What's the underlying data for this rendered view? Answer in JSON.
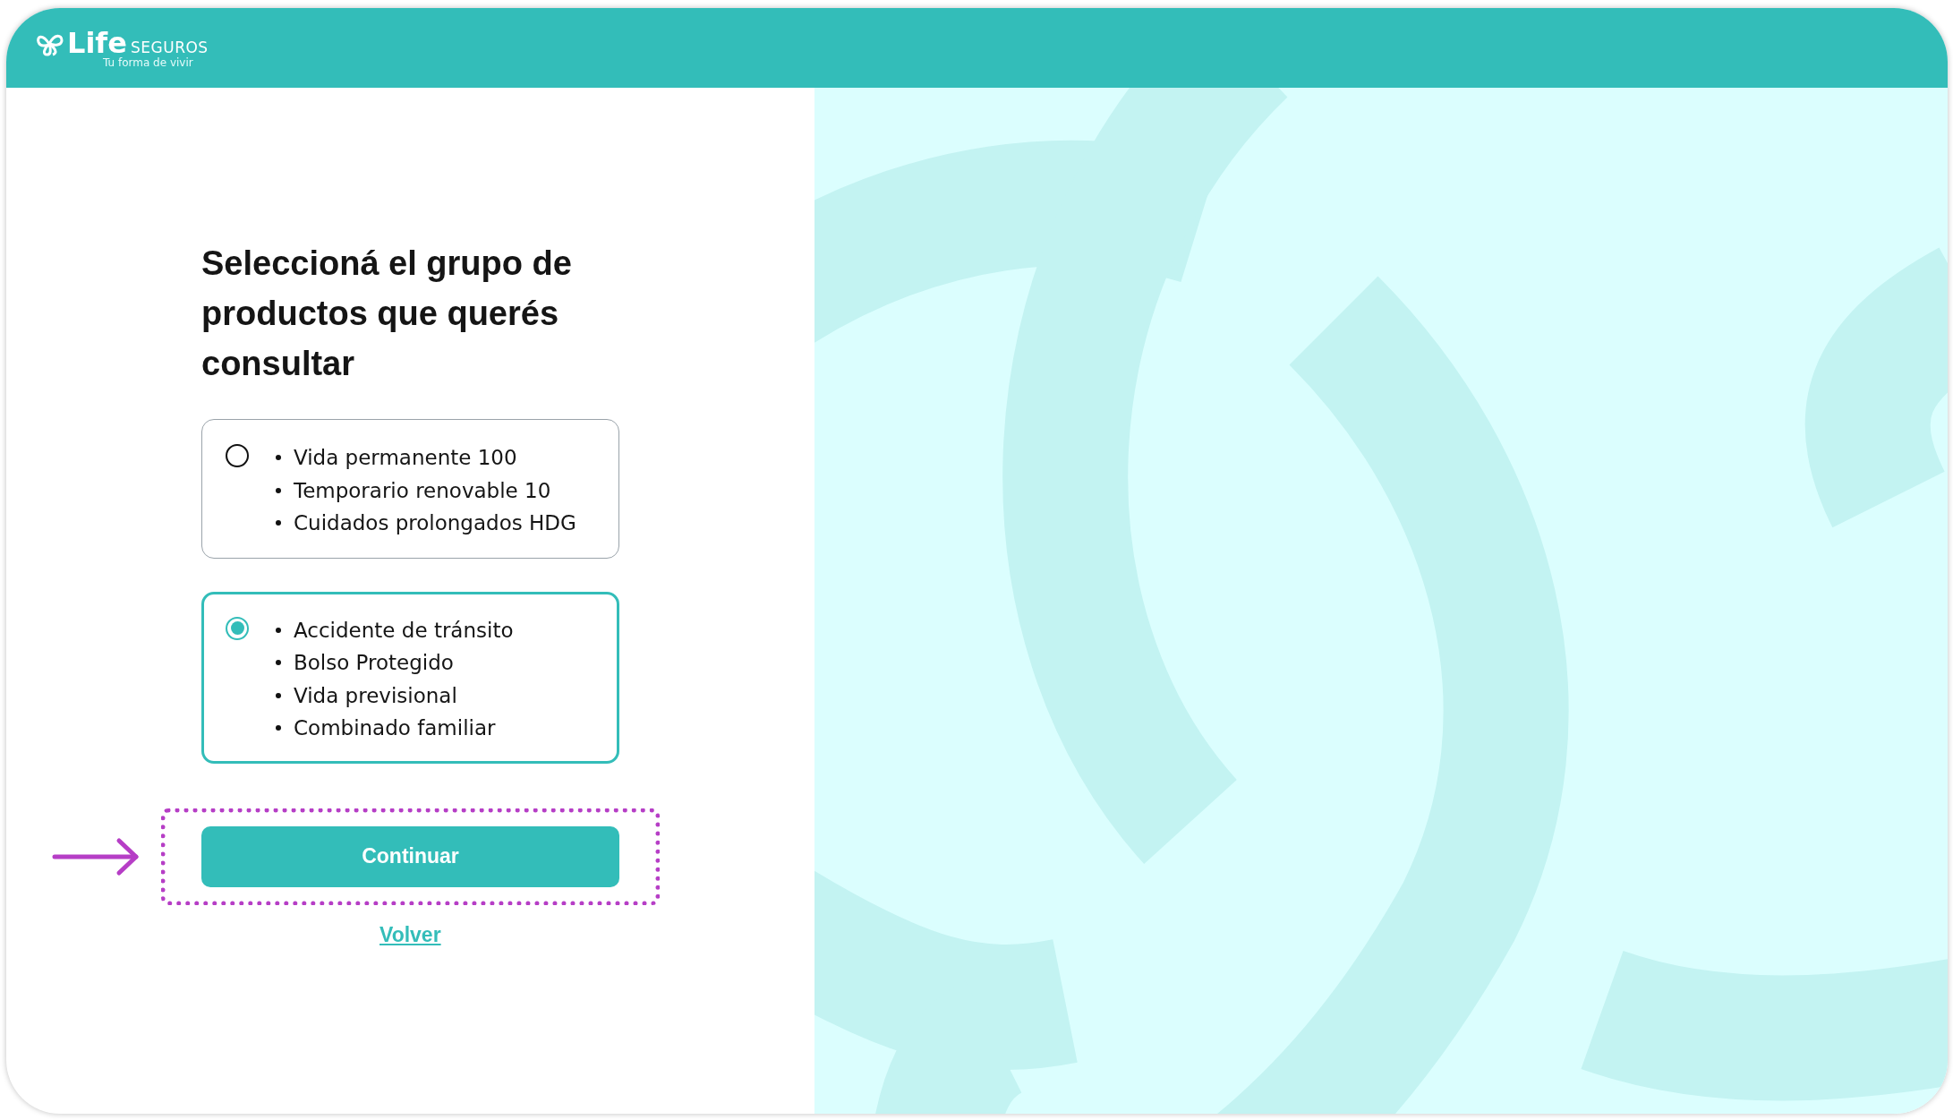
{
  "header": {
    "brand": "Life",
    "brand_suffix": "SEGUROS",
    "tagline": "Tu forma de vivir"
  },
  "title": "Seleccioná el grupo de productos que querés consultar",
  "options": [
    {
      "selected": false,
      "items": [
        "Vida permanente 100",
        "Temporario renovable 10",
        "Cuidados prolongados HDG"
      ]
    },
    {
      "selected": true,
      "items": [
        "Accidente de tránsito",
        "Bolso Protegido",
        "Vida previsional",
        "Combinado familiar"
      ]
    }
  ],
  "continue_button": {
    "label": "Continuar",
    "highlighted": true
  },
  "back_link": "Volver"
}
